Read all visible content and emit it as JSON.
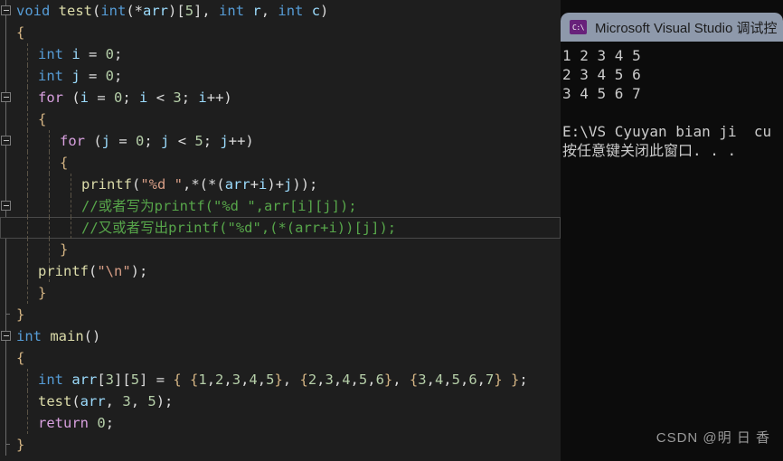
{
  "editor": {
    "lines": [
      {
        "indent": 0,
        "fold": true,
        "blockbar": "start",
        "guides": [],
        "tokens": [
          {
            "t": "void ",
            "c": "kw"
          },
          {
            "t": "test",
            "c": "fn"
          },
          {
            "t": "(",
            "c": "pun"
          },
          {
            "t": "int",
            "c": "kw"
          },
          {
            "t": "(*",
            "c": "pun"
          },
          {
            "t": "arr",
            "c": "var"
          },
          {
            "t": ")[",
            "c": "pun"
          },
          {
            "t": "5",
            "c": "num"
          },
          {
            "t": "], ",
            "c": "pun"
          },
          {
            "t": "int ",
            "c": "kw"
          },
          {
            "t": "r",
            "c": "var"
          },
          {
            "t": ", ",
            "c": "pun"
          },
          {
            "t": "int ",
            "c": "kw"
          },
          {
            "t": "c",
            "c": "var"
          },
          {
            "t": ")",
            "c": "pun"
          }
        ]
      },
      {
        "indent": 0,
        "fold": false,
        "blockbar": "mid",
        "guides": [],
        "tokens": [
          {
            "t": "{",
            "c": "brc"
          }
        ]
      },
      {
        "indent": 1,
        "fold": false,
        "blockbar": "mid",
        "guides": [
          0
        ],
        "tokens": [
          {
            "t": "int ",
            "c": "kw"
          },
          {
            "t": "i",
            "c": "var"
          },
          {
            "t": " = ",
            "c": "pun"
          },
          {
            "t": "0",
            "c": "num"
          },
          {
            "t": ";",
            "c": "pun"
          }
        ]
      },
      {
        "indent": 1,
        "fold": false,
        "blockbar": "mid",
        "guides": [
          0
        ],
        "tokens": [
          {
            "t": "int ",
            "c": "kw"
          },
          {
            "t": "j",
            "c": "var"
          },
          {
            "t": " = ",
            "c": "pun"
          },
          {
            "t": "0",
            "c": "num"
          },
          {
            "t": ";",
            "c": "pun"
          }
        ]
      },
      {
        "indent": 1,
        "fold": true,
        "blockbar": "mid",
        "guides": [
          0
        ],
        "tokens": [
          {
            "t": "for",
            "c": "ctl"
          },
          {
            "t": " (",
            "c": "pun"
          },
          {
            "t": "i",
            "c": "var"
          },
          {
            "t": " = ",
            "c": "pun"
          },
          {
            "t": "0",
            "c": "num"
          },
          {
            "t": "; ",
            "c": "pun"
          },
          {
            "t": "i",
            "c": "var"
          },
          {
            "t": " < ",
            "c": "pun"
          },
          {
            "t": "3",
            "c": "num"
          },
          {
            "t": "; ",
            "c": "pun"
          },
          {
            "t": "i",
            "c": "var"
          },
          {
            "t": "++)",
            "c": "pun"
          }
        ]
      },
      {
        "indent": 1,
        "fold": false,
        "blockbar": "mid",
        "guides": [
          0
        ],
        "tokens": [
          {
            "t": "{",
            "c": "brc"
          }
        ]
      },
      {
        "indent": 2,
        "fold": true,
        "blockbar": "mid",
        "guides": [
          0,
          1
        ],
        "tokens": [
          {
            "t": "for",
            "c": "ctl"
          },
          {
            "t": " (",
            "c": "pun"
          },
          {
            "t": "j",
            "c": "var"
          },
          {
            "t": " = ",
            "c": "pun"
          },
          {
            "t": "0",
            "c": "num"
          },
          {
            "t": "; ",
            "c": "pun"
          },
          {
            "t": "j",
            "c": "var"
          },
          {
            "t": " < ",
            "c": "pun"
          },
          {
            "t": "5",
            "c": "num"
          },
          {
            "t": "; ",
            "c": "pun"
          },
          {
            "t": "j",
            "c": "var"
          },
          {
            "t": "++)",
            "c": "pun"
          }
        ]
      },
      {
        "indent": 2,
        "fold": false,
        "blockbar": "mid",
        "guides": [
          0,
          1
        ],
        "tokens": [
          {
            "t": "{",
            "c": "brc"
          }
        ]
      },
      {
        "indent": 3,
        "fold": false,
        "blockbar": "mid",
        "guides": [
          0,
          1,
          2
        ],
        "tokens": [
          {
            "t": "printf",
            "c": "fn"
          },
          {
            "t": "(",
            "c": "pun"
          },
          {
            "t": "\"%d \"",
            "c": "str"
          },
          {
            "t": ",*(*(",
            "c": "pun"
          },
          {
            "t": "arr",
            "c": "var"
          },
          {
            "t": "+",
            "c": "pun"
          },
          {
            "t": "i",
            "c": "var"
          },
          {
            "t": ")+",
            "c": "pun"
          },
          {
            "t": "j",
            "c": "var"
          },
          {
            "t": "));",
            "c": "pun"
          }
        ]
      },
      {
        "indent": 3,
        "fold": true,
        "blockbar": "mid",
        "guides": [
          0,
          1,
          2
        ],
        "tokens": [
          {
            "t": "//或者写为printf(\"%d \",arr[i][j]);",
            "c": "cmt"
          }
        ]
      },
      {
        "indent": 3,
        "fold": false,
        "blockbar": "none",
        "current": true,
        "guides": [
          0,
          1,
          2
        ],
        "tokens": [
          {
            "t": "//又或者写出printf(\"%d\",(*(arr+i))[j]);",
            "c": "cmt"
          }
        ]
      },
      {
        "indent": 2,
        "fold": false,
        "blockbar": "mid",
        "guides": [
          0,
          1
        ],
        "tokens": [
          {
            "t": "}",
            "c": "brc"
          }
        ]
      },
      {
        "indent": 1,
        "fold": false,
        "blockbar": "mid",
        "guides": [
          0,
          1
        ],
        "tokens": [
          {
            "t": "printf",
            "c": "fn"
          },
          {
            "t": "(",
            "c": "pun"
          },
          {
            "t": "\"\\n\"",
            "c": "str"
          },
          {
            "t": ");",
            "c": "pun"
          }
        ]
      },
      {
        "indent": 1,
        "fold": false,
        "blockbar": "mid",
        "guides": [
          0
        ],
        "tokens": [
          {
            "t": "}",
            "c": "brc"
          }
        ]
      },
      {
        "indent": 0,
        "fold": false,
        "blockbar": "end",
        "guides": [],
        "tokens": [
          {
            "t": "}",
            "c": "brc"
          }
        ]
      },
      {
        "indent": 0,
        "fold": true,
        "blockbar": "start",
        "guides": [],
        "tokens": [
          {
            "t": "int ",
            "c": "kw"
          },
          {
            "t": "main",
            "c": "fn"
          },
          {
            "t": "()",
            "c": "pun"
          }
        ]
      },
      {
        "indent": 0,
        "fold": false,
        "blockbar": "mid",
        "guides": [],
        "tokens": [
          {
            "t": "{",
            "c": "brc"
          }
        ]
      },
      {
        "indent": 1,
        "fold": false,
        "blockbar": "mid",
        "guides": [
          0
        ],
        "tokens": [
          {
            "t": "int ",
            "c": "kw"
          },
          {
            "t": "arr",
            "c": "var"
          },
          {
            "t": "[",
            "c": "pun"
          },
          {
            "t": "3",
            "c": "num"
          },
          {
            "t": "][",
            "c": "pun"
          },
          {
            "t": "5",
            "c": "num"
          },
          {
            "t": "] = ",
            "c": "pun"
          },
          {
            "t": "{ {",
            "c": "brc"
          },
          {
            "t": "1",
            "c": "num"
          },
          {
            "t": ",",
            "c": "pun"
          },
          {
            "t": "2",
            "c": "num"
          },
          {
            "t": ",",
            "c": "pun"
          },
          {
            "t": "3",
            "c": "num"
          },
          {
            "t": ",",
            "c": "pun"
          },
          {
            "t": "4",
            "c": "num"
          },
          {
            "t": ",",
            "c": "pun"
          },
          {
            "t": "5",
            "c": "num"
          },
          {
            "t": "}",
            "c": "brc"
          },
          {
            "t": ", ",
            "c": "pun"
          },
          {
            "t": "{",
            "c": "brc"
          },
          {
            "t": "2",
            "c": "num"
          },
          {
            "t": ",",
            "c": "pun"
          },
          {
            "t": "3",
            "c": "num"
          },
          {
            "t": ",",
            "c": "pun"
          },
          {
            "t": "4",
            "c": "num"
          },
          {
            "t": ",",
            "c": "pun"
          },
          {
            "t": "5",
            "c": "num"
          },
          {
            "t": ",",
            "c": "pun"
          },
          {
            "t": "6",
            "c": "num"
          },
          {
            "t": "}",
            "c": "brc"
          },
          {
            "t": ", ",
            "c": "pun"
          },
          {
            "t": "{",
            "c": "brc"
          },
          {
            "t": "3",
            "c": "num"
          },
          {
            "t": ",",
            "c": "pun"
          },
          {
            "t": "4",
            "c": "num"
          },
          {
            "t": ",",
            "c": "pun"
          },
          {
            "t": "5",
            "c": "num"
          },
          {
            "t": ",",
            "c": "pun"
          },
          {
            "t": "6",
            "c": "num"
          },
          {
            "t": ",",
            "c": "pun"
          },
          {
            "t": "7",
            "c": "num"
          },
          {
            "t": "} }",
            "c": "brc"
          },
          {
            "t": ";",
            "c": "pun"
          }
        ]
      },
      {
        "indent": 1,
        "fold": false,
        "blockbar": "mid",
        "guides": [
          0
        ],
        "tokens": [
          {
            "t": "test",
            "c": "fn"
          },
          {
            "t": "(",
            "c": "pun"
          },
          {
            "t": "arr",
            "c": "var"
          },
          {
            "t": ", ",
            "c": "pun"
          },
          {
            "t": "3",
            "c": "num"
          },
          {
            "t": ", ",
            "c": "pun"
          },
          {
            "t": "5",
            "c": "num"
          },
          {
            "t": ");",
            "c": "pun"
          }
        ]
      },
      {
        "indent": 1,
        "fold": false,
        "blockbar": "mid",
        "guides": [
          0
        ],
        "tokens": [
          {
            "t": "return",
            "c": "ctl"
          },
          {
            "t": " ",
            "c": "pun"
          },
          {
            "t": "0",
            "c": "num"
          },
          {
            "t": ";",
            "c": "pun"
          }
        ]
      },
      {
        "indent": 0,
        "fold": false,
        "blockbar": "end",
        "guides": [],
        "tokens": [
          {
            "t": "}",
            "c": "brc"
          }
        ]
      }
    ]
  },
  "console": {
    "title": "Microsoft Visual Studio 调试控",
    "icon_label": "C:\\",
    "output": [
      "1 2 3 4 5",
      "2 3 4 5 6",
      "3 4 5 6 7",
      "",
      "E:\\VS Cyuyan bian ji  cu",
      "按任意键关闭此窗口. . ."
    ]
  },
  "watermark": {
    "text": "CSDN @明 日 香"
  },
  "colors": {
    "editor_background": "#1e1e1e",
    "console_background": "#0c0c0c",
    "titlebar": "#8e99ab",
    "keyword": "#569cd6",
    "control": "#d8a0df",
    "function": "#dcdcaa",
    "identifier": "#9cdcfe",
    "number": "#b5cea8",
    "string": "#d69d85",
    "comment": "#57a64a",
    "brace": "#d4b483",
    "icon_purple": "#68217a"
  }
}
